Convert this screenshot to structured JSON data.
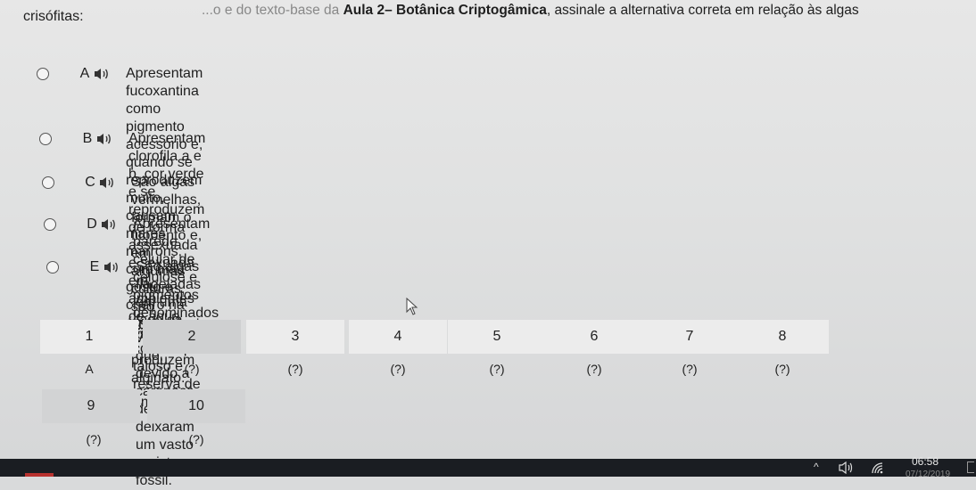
{
  "question": {
    "line1_faded": "...o e do texto-base da",
    "line1_bold": "Aula 2– Botânica Criptogâmica",
    "line1_rest": ", assinale a alternativa correta em relação às algas",
    "line2": "crisófitas:"
  },
  "options": [
    {
      "letter": "A",
      "text_line1": "Apresentam fucoxantina como pigmento acessório e, quando se reproduzem muito, causam marés marrons, com mau gosto e",
      "text_line2": "cheiro na água."
    },
    {
      "letter": "B",
      "text_line1": "Apresentam clorofila a e b, cor verde e se reproduzem de forma assexuada e sexuada em ambientes de água doce.",
      "text_line2": ""
    },
    {
      "letter": "C",
      "text_line1": "São algas vermelhas, formam o fitobento e, em algumas culturas, são comestíveis e produzem alginato.",
      "text_line2": ""
    },
    {
      "letter": "D",
      "text_line1": "Apresentam parede celular de celulose e pigmentos denominados carotenoides, com corpo taloso e reserva de amido.",
      "text_line2": ""
    },
    {
      "letter": "E",
      "text_line1": "São algas flageladas em uma fase da vida e que, devido a carapaça de sílica, deixaram um vasto registro fóssil.",
      "text_line2": ""
    }
  ],
  "navigation": {
    "row1": [
      {
        "num": "1",
        "answer": "A"
      },
      {
        "num": "2",
        "answer": "(?)"
      },
      {
        "num": "3",
        "answer": "(?)"
      },
      {
        "num": "4",
        "answer": "(?)"
      },
      {
        "num": "5",
        "answer": "(?)"
      },
      {
        "num": "6",
        "answer": "(?)"
      },
      {
        "num": "7",
        "answer": "(?)"
      },
      {
        "num": "8",
        "answer": "(?)"
      }
    ],
    "row2": [
      {
        "num": "9",
        "answer": "(?)"
      },
      {
        "num": "10",
        "answer": "(?)"
      }
    ]
  },
  "taskbar": {
    "time": "06:58",
    "date": "07/12/2019",
    "chevron": "^"
  },
  "icons": {
    "speaker": "speaker-icon",
    "mouse_cursor": "mouse-cursor-icon",
    "volume": "volume-icon",
    "wifi": "wifi-icon"
  }
}
